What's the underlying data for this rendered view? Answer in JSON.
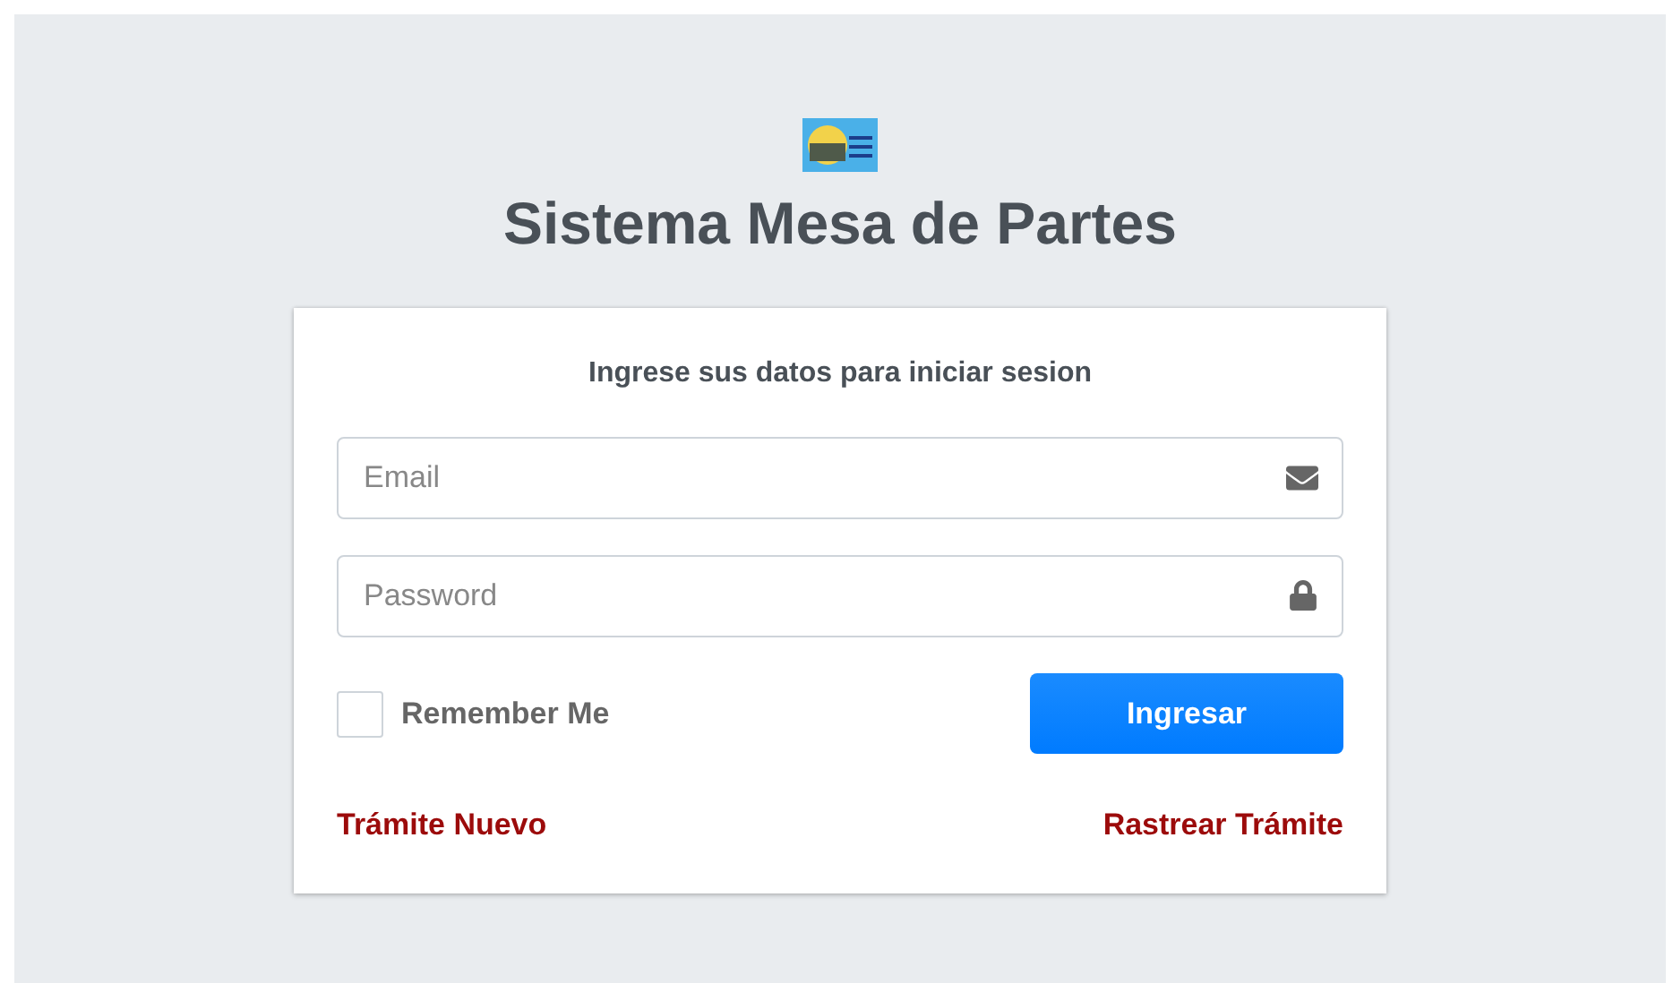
{
  "title": "Sistema Mesa de Partes",
  "login": {
    "message": "Ingrese sus datos para iniciar sesion",
    "fields": [
      {
        "kind": "email",
        "placeholder": "Email"
      },
      {
        "kind": "password",
        "placeholder": "Password"
      }
    ],
    "remember": {
      "label": "Remember Me",
      "checked": false
    },
    "submit": "Ingresar",
    "links": [
      "Trámite Nuevo",
      "Rastrear Trámite"
    ]
  }
}
